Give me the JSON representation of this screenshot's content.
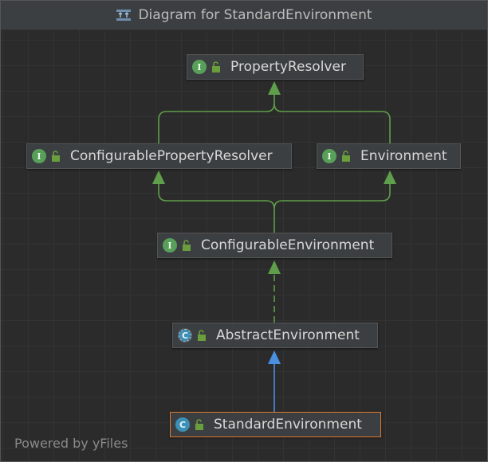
{
  "window": {
    "title": "Diagram for StandardEnvironment",
    "title_icon": "diagram-icon"
  },
  "diagram": {
    "nodes": [
      {
        "id": "property-resolver",
        "label": "PropertyResolver",
        "kind": "interface",
        "badge": "I"
      },
      {
        "id": "configurable-property-resolver",
        "label": "ConfigurablePropertyResolver",
        "kind": "interface",
        "badge": "I"
      },
      {
        "id": "environment",
        "label": "Environment",
        "kind": "interface",
        "badge": "I"
      },
      {
        "id": "configurable-environment",
        "label": "ConfigurableEnvironment",
        "kind": "interface",
        "badge": "I"
      },
      {
        "id": "abstract-environment",
        "label": "AbstractEnvironment",
        "kind": "abstract-class",
        "badge": "C"
      },
      {
        "id": "standard-environment",
        "label": "StandardEnvironment",
        "kind": "class",
        "badge": "C",
        "selected": true
      }
    ],
    "edges": [
      {
        "from": "configurable-property-resolver",
        "to": "property-resolver",
        "type": "extends"
      },
      {
        "from": "environment",
        "to": "property-resolver",
        "type": "extends"
      },
      {
        "from": "configurable-environment",
        "to": "configurable-property-resolver",
        "type": "extends"
      },
      {
        "from": "configurable-environment",
        "to": "environment",
        "type": "extends"
      },
      {
        "from": "abstract-environment",
        "to": "configurable-environment",
        "type": "implements"
      },
      {
        "from": "standard-environment",
        "to": "abstract-environment",
        "type": "extends-class"
      }
    ],
    "colors": {
      "interface_edge": "#5f9e4a",
      "class_edge": "#4a8fe0",
      "selected_border": "#e07b2f",
      "interface_badge": "#58a05a",
      "class_badge": "#3c8fb5"
    }
  },
  "footer": {
    "powered_by": "Powered by yFiles"
  }
}
